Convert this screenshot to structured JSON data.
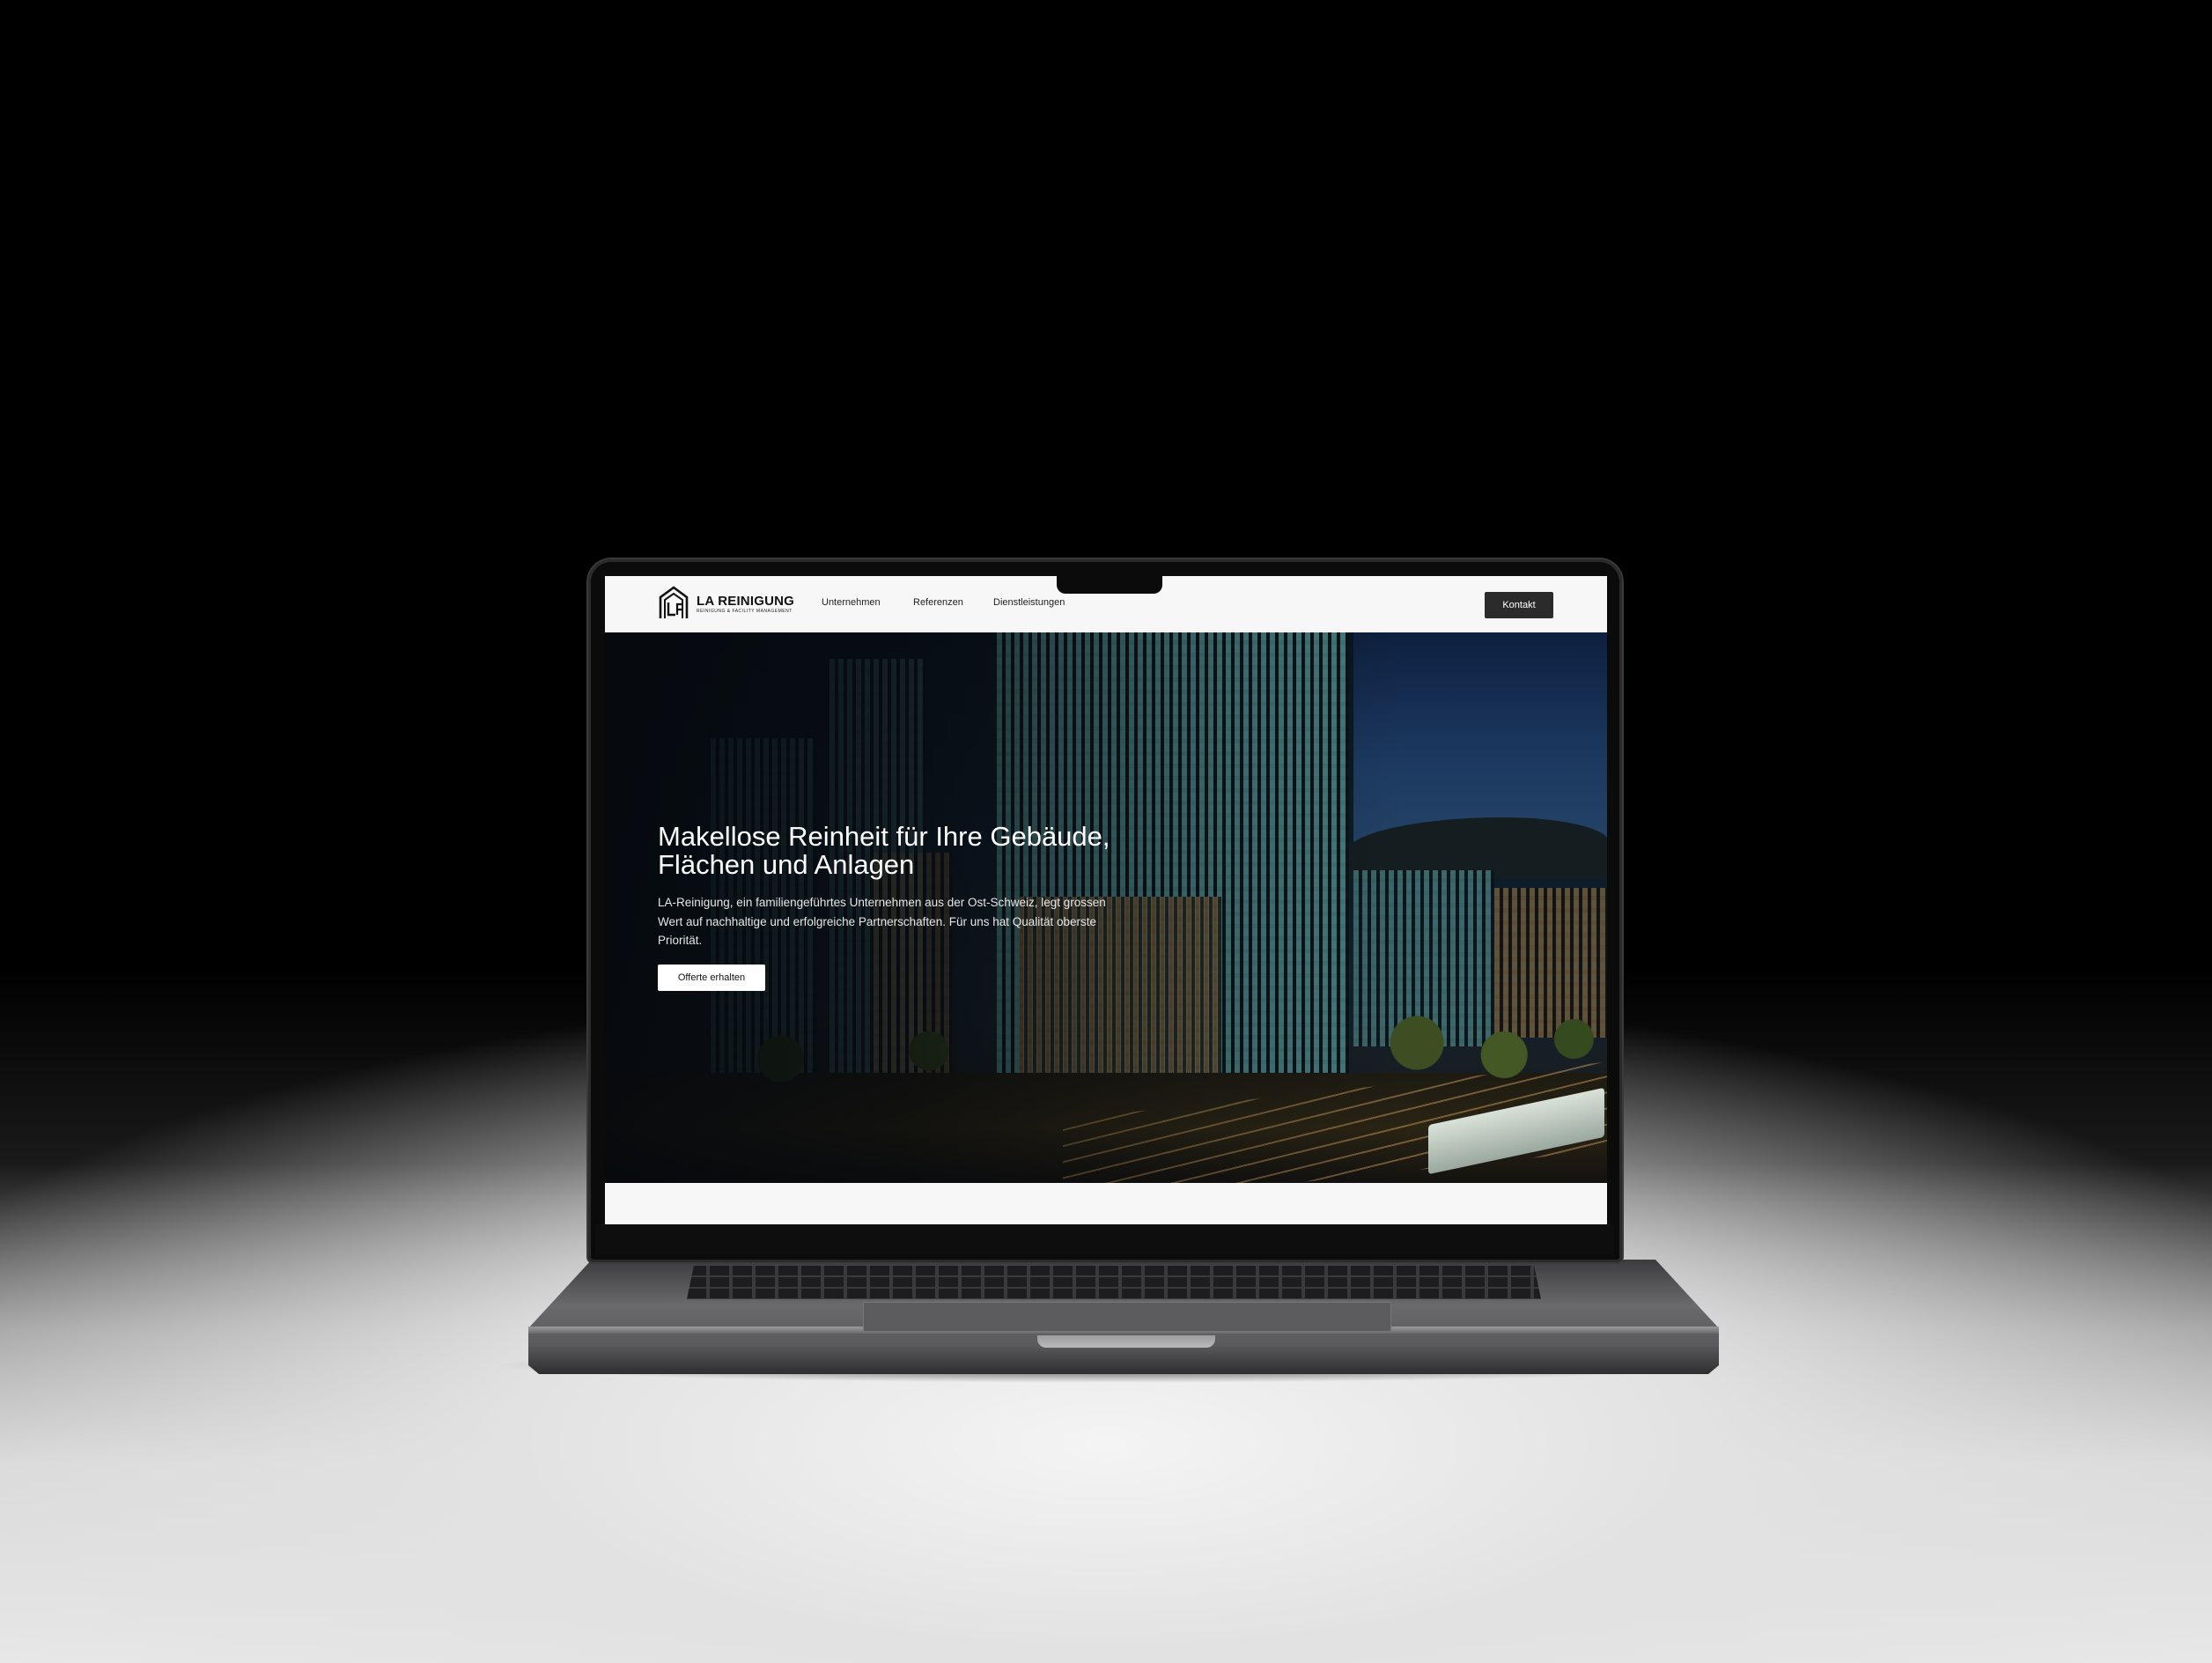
{
  "nav": {
    "logo_title": "LA REINIGUNG",
    "logo_subtitle": "Reinigung & Facility Management",
    "links": [
      "Unternehmen",
      "Referenzen",
      "Dienstleistungen"
    ],
    "cta": "Kontakt"
  },
  "hero": {
    "title_line1": "Makellose Reinheit für Ihre Gebäude,",
    "title_line2": "Flächen und Anlagen",
    "body": "LA-Reinigung, ein familiengeführtes Unternehmen aus der Ost-Schweiz, legt grossen Wert auf nachhaltige und erfolgreiche Partnerschaften. Für uns hat Qualität oberste Priorität.",
    "button": "Offerte erhalten"
  },
  "icons": {
    "logo": "house-logo-icon"
  },
  "colors": {
    "nav_bg": "#f7f7f7",
    "cta_bg": "#2b2b2b",
    "hero_text": "#ffffff"
  }
}
